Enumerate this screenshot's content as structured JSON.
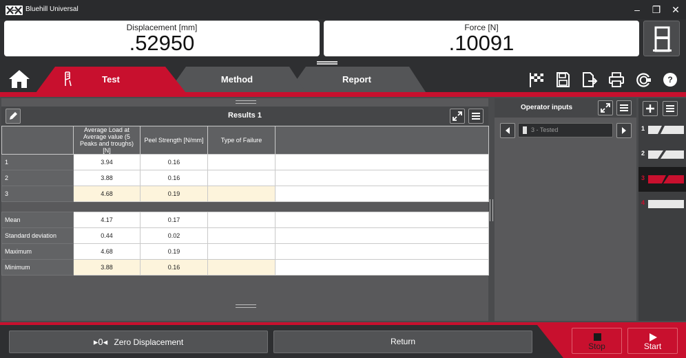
{
  "app": {
    "title": "Bluehill Universal"
  },
  "window": {
    "minimize": "–",
    "maximize": "❐",
    "close": "✕"
  },
  "readouts": [
    {
      "label": "Displacement [mm]",
      "value": ".52950"
    },
    {
      "label": "Force [N]",
      "value": ".10091"
    }
  ],
  "tabs": [
    {
      "label": "Test",
      "active": true
    },
    {
      "label": "Method",
      "active": false
    },
    {
      "label": "Report",
      "active": false
    }
  ],
  "toolbar_icons": [
    "finish-flag-icon",
    "save-icon",
    "export-icon",
    "print-icon",
    "load-frame-icon",
    "help-icon"
  ],
  "help_label": "?",
  "results": {
    "title": "Results 1",
    "columns": [
      "",
      "Average Load at Average value (5 Peaks and troughs) [N]",
      "Peel Strength [N/mm]",
      "Type of Failure",
      ""
    ],
    "rows": [
      {
        "label": "1",
        "values": [
          "3.94",
          "0.16",
          ""
        ],
        "highlight": false
      },
      {
        "label": "2",
        "values": [
          "3.88",
          "0.16",
          ""
        ],
        "highlight": false
      },
      {
        "label": "3",
        "values": [
          "4.68",
          "0.19",
          ""
        ],
        "highlight": true
      }
    ],
    "stats": [
      {
        "label": "Mean",
        "values": [
          "4.17",
          "0.17",
          ""
        ],
        "highlight": false
      },
      {
        "label": "Standard deviation",
        "values": [
          "0.44",
          "0.02",
          ""
        ],
        "highlight": false
      },
      {
        "label": "Maximum",
        "values": [
          "4.68",
          "0.19",
          ""
        ],
        "highlight": false
      },
      {
        "label": "Minimum",
        "values": [
          "3.88",
          "0.16",
          ""
        ],
        "highlight": true
      }
    ]
  },
  "operator_inputs": {
    "title": "Operator inputs",
    "selected_specimen": "3 - Tested"
  },
  "specimens": [
    {
      "number": "1",
      "state": "tested"
    },
    {
      "number": "2",
      "state": "tested"
    },
    {
      "number": "3",
      "state": "current"
    },
    {
      "number": "4",
      "state": "untested"
    }
  ],
  "footer": {
    "zero_icon": "▸0◂",
    "zero_label": "Zero Displacement",
    "return_label": "Return",
    "stop_label": "Stop",
    "start_label": "Start"
  },
  "colors": {
    "accent": "#c8102e",
    "background": "#2e2f31",
    "highlight_row": "#fdf4dc"
  }
}
